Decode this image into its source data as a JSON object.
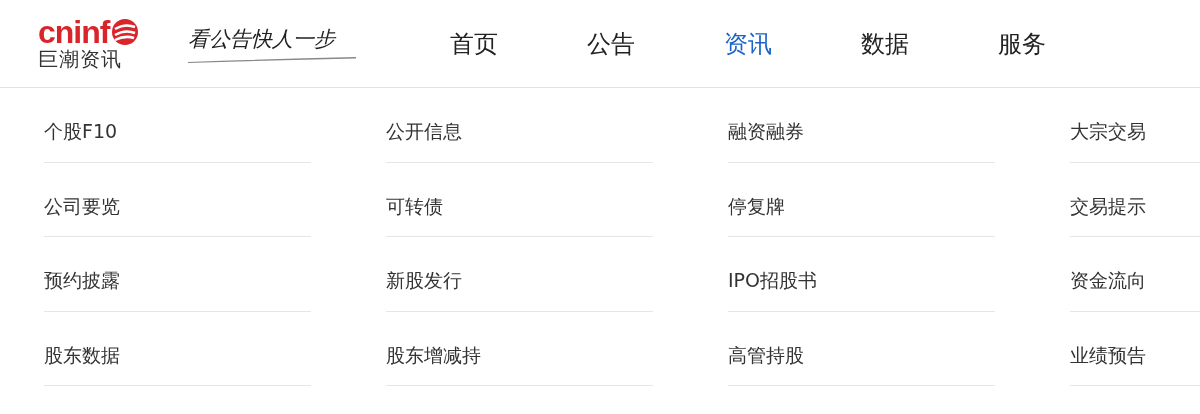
{
  "logo": {
    "wordmark": "cninf",
    "name": "巨潮资讯"
  },
  "slogan": "看公告快人一步",
  "nav": [
    {
      "label": "首页",
      "selected": false
    },
    {
      "label": "公告",
      "selected": false
    },
    {
      "label": "资讯",
      "selected": true
    },
    {
      "label": "数据",
      "selected": false
    },
    {
      "label": "服务",
      "selected": false
    }
  ],
  "menu_columns": [
    [
      "个股F10",
      "公司要览",
      "预约披露",
      "股东数据"
    ],
    [
      "公开信息",
      "可转债",
      "新股发行",
      "股东增减持"
    ],
    [
      "融资融券",
      "停复牌",
      "IPO招股书",
      "高管持股"
    ],
    [
      "大宗交易",
      "交易提示",
      "资金流向",
      "业绩预告"
    ]
  ]
}
